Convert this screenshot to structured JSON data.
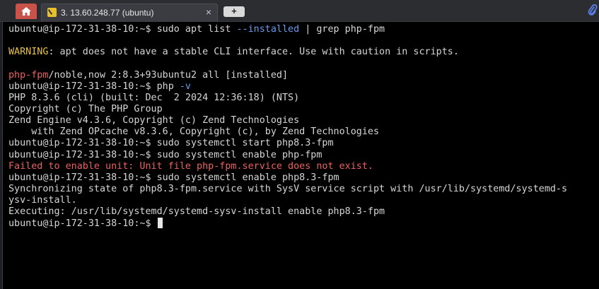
{
  "window": {
    "tab_title": "3. 13.60.248.77 (ubuntu)",
    "close_glyph": "×",
    "new_tab_glyph": "+"
  },
  "terminal": {
    "l1": {
      "prompt": "ubuntu@ip-172-31-38-10:~$ ",
      "cmd": "sudo apt list ",
      "flag": "--installed",
      "rest": " | grep php-fpm"
    },
    "l2": {
      "text": ""
    },
    "l3": {
      "label": "WARNING",
      "rest": ": apt does not have a stable CLI interface. Use with caution in scripts."
    },
    "l4": {
      "text": ""
    },
    "l5": {
      "pkg": "php-fpm",
      "rest": "/noble,now 2:8.3+93ubuntu2 all [installed]"
    },
    "l6": {
      "prompt": "ubuntu@ip-172-31-38-10:~$ ",
      "cmd": "php ",
      "flag": "-v"
    },
    "l7": {
      "text": "PHP 8.3.6 (cli) (built: Dec  2 2024 12:36:18) (NTS)"
    },
    "l8": {
      "text": "Copyright (c) The PHP Group"
    },
    "l9": {
      "text": "Zend Engine v4.3.6, Copyright (c) Zend Technologies"
    },
    "l10": {
      "text": "    with Zend OPcache v8.3.6, Copyright (c), by Zend Technologies"
    },
    "l11": {
      "text": "ubuntu@ip-172-31-38-10:~$ sudo systemctl start php8.3-fpm"
    },
    "l12": {
      "text": "ubuntu@ip-172-31-38-10:~$ sudo systemctl enable php-fpm"
    },
    "l13": {
      "text": "Failed to enable unit: Unit file php-fpm.service does not exist."
    },
    "l14": {
      "text": "ubuntu@ip-172-31-38-10:~$ sudo systemctl enable php8.3-fpm"
    },
    "l15": {
      "text": "Synchronizing state of php8.3-fpm.service with SysV service script with /usr/lib/systemd/systemd-s"
    },
    "l16": {
      "text": "ysv-install."
    },
    "l17": {
      "text": "Executing: /usr/lib/systemd/systemd-sysv-install enable php8.3-fpm"
    },
    "l18": {
      "prompt": "ubuntu@ip-172-31-38-10:~$ "
    }
  },
  "colors": {
    "background": "#000000",
    "text": "#d6d6d6",
    "flag": "#6b9cf0",
    "warning": "#e8c23a",
    "error": "#ee5f5f",
    "home_tab": "#c9534a"
  },
  "icons": [
    "home-icon",
    "session-icon",
    "close-icon",
    "plus-icon",
    "paperclip-icon"
  ]
}
